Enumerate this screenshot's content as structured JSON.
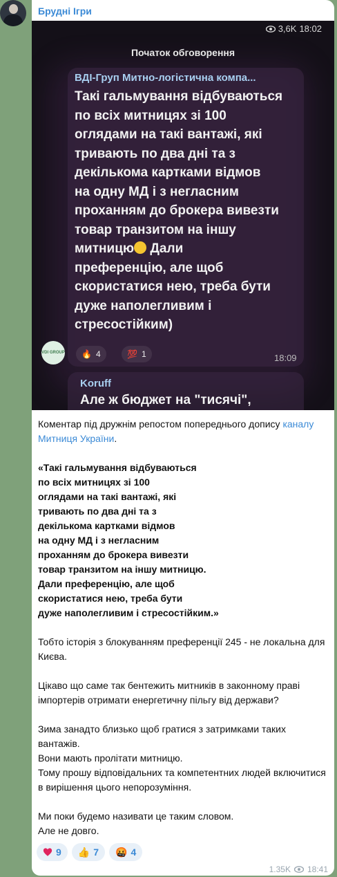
{
  "channel": {
    "name": "Брудні Ігри"
  },
  "photo": {
    "views": "3,6K",
    "time": "18:02",
    "discussion_header": "Початок обговорення",
    "sender": "ВДІ-Груп Митно-логістична компа...",
    "quote_lines": [
      "Такі гальмування відбуваються",
      "по всіх митницях зі 100",
      "оглядами на такі вантажі, які",
      "тривають по два дні та з",
      "декількома картками відмов",
      "на одну МД і з негласним",
      "проханням до брокера вивезти",
      "товар транзитом на іншу",
      "митницю",
      "Дали",
      "преференцію, але щоб",
      "скористатися нею, треба бути",
      "дуже наполегливим і",
      "стресостійким)"
    ],
    "logo_text": "VDI GROUP",
    "reactions": [
      {
        "emoji": "🔥",
        "count": "4"
      },
      {
        "emoji": "💯",
        "count": "1"
      }
    ],
    "msg_time": "18:09",
    "sender2": "Koruff",
    "line2": "Але ж бюджет на \"тисячі\","
  },
  "post": {
    "intro_before_link": "Коментар під дружнім репостом попереднього допису ",
    "link_text": "каналу Митниця України",
    "intro_after_link": ".",
    "quote_lines": [
      "«Такі гальмування відбуваються",
      "по всіх митницях зі 100",
      "оглядами на такі вантажі, які",
      "тривають по два дні та з",
      "декількома картками відмов",
      "на одну МД і з негласним",
      "проханням до брокера вивезти",
      "товар транзитом на іншу митницю.",
      "Дали преференцію, але щоб",
      "скористатися нею, треба бути",
      "дуже наполегливим і стресостійким.»"
    ],
    "paragraph1": "Тобто історія з блокуванням преференції 245 - не локальна для Києва.",
    "paragraph2": "Цікаво що саме так бентежить митників в законному праві імпортерів отримати енергетичну пільгу від держави?",
    "paragraph3_lines": [
      "Зима занадто близько щоб гратися з затримками таких вантажів.",
      "Вони мають пролітати митницю.",
      "Тому прошу відповідальних та компетентних людей включитися в вирішення цього непорозуміння."
    ],
    "paragraph4_lines": [
      "Ми поки будемо називати це таким словом.",
      "Але не довго."
    ]
  },
  "reactions": [
    {
      "emoji": "❤️",
      "count": "9",
      "icon": "heart-icon"
    },
    {
      "emoji": "👍",
      "count": "7",
      "icon": "thumbs-up-icon"
    },
    {
      "emoji": "🤬",
      "count": "4",
      "icon": "angry-face-icon"
    }
  ],
  "footer": {
    "views": "1.35K",
    "time": "18:41"
  },
  "colors": {
    "accent": "#3b8ad6",
    "background": "#7fa17a",
    "bubble": "#ffffff"
  }
}
